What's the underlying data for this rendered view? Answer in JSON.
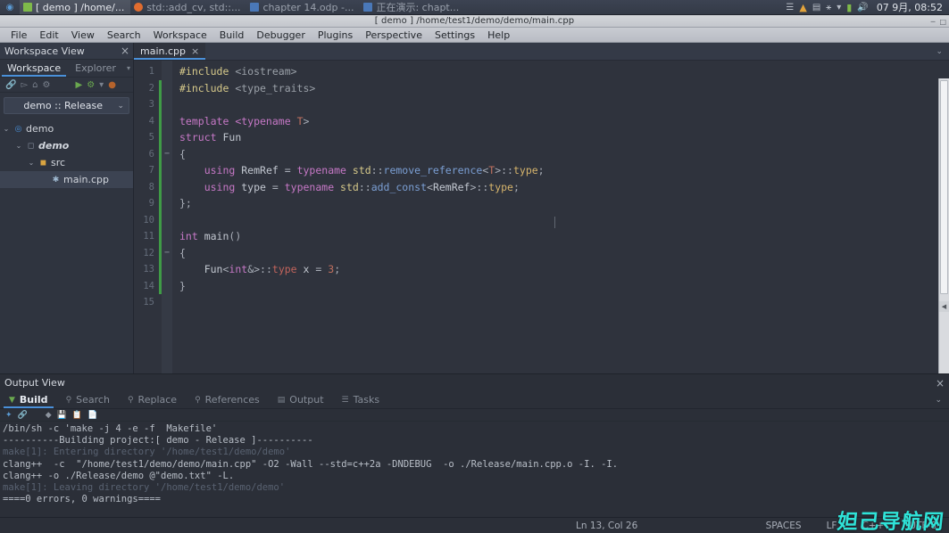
{
  "taskbar": {
    "start_icon": "start-menu-icon",
    "items": [
      {
        "label": "[ demo ] /home/...",
        "icon": "window-icon",
        "active": true
      },
      {
        "label": "std::add_cv, std::...",
        "icon": "browser-icon",
        "active": false
      },
      {
        "label": "chapter 14.odp -...",
        "icon": "presentation-icon",
        "active": false
      },
      {
        "label": "正在演示: chapt...",
        "icon": "presentation-icon",
        "active": false
      }
    ],
    "tray": {
      "network": "network-icon",
      "warning": "warning-icon",
      "keyboard": "keyboard-icon",
      "bluetooth": "bluetooth-icon",
      "wifi": "wifi-icon",
      "battery": "battery-icon",
      "volume": "volume-icon",
      "clock": "07 9月, 08:52"
    }
  },
  "window": {
    "title": "[ demo ] /home/test1/demo/demo/main.cpp",
    "buttons": [
      "minimize",
      "maximize",
      "close"
    ]
  },
  "menubar": {
    "items": [
      "File",
      "Edit",
      "View",
      "Search",
      "Workspace",
      "Build",
      "Debugger",
      "Plugins",
      "Perspective",
      "Settings",
      "Help"
    ]
  },
  "workspace_view": {
    "title": "Workspace View",
    "close": "×",
    "tabs": [
      {
        "label": "Workspace",
        "selected": true
      },
      {
        "label": "Explorer",
        "selected": false
      }
    ],
    "tabs_overflow": "▾",
    "toolbar_icons": [
      "link-icon",
      "send-icon",
      "home-icon",
      "wrench-icon",
      "run-icon",
      "build-icon",
      "dropdown-icon",
      "stop-icon"
    ],
    "config_selector": {
      "value": "demo :: Release",
      "chevron": "⌄"
    },
    "tree": [
      {
        "label": "demo",
        "depth": 0,
        "twisty": "⌄",
        "icon": "project-icon",
        "style": "normal",
        "selected": false
      },
      {
        "label": "demo",
        "depth": 1,
        "twisty": "⌄",
        "icon": "folder-icon",
        "style": "bold-italic",
        "selected": false
      },
      {
        "label": "src",
        "depth": 2,
        "twisty": "⌄",
        "icon": "folder-open-icon",
        "style": "normal",
        "selected": false
      },
      {
        "label": "main.cpp",
        "depth": 3,
        "twisty": "",
        "icon": "cpp-file-icon",
        "style": "normal",
        "selected": true
      }
    ]
  },
  "editor": {
    "tabs": [
      {
        "label": "main.cpp",
        "close": "×",
        "selected": true
      }
    ],
    "overflow_chevron": "⌄",
    "line_count": 15,
    "change_bar": {
      "from_line": 2,
      "to_line": 14,
      "color": "#3f9b46"
    },
    "fold_markers": {
      "6": "−",
      "12": "−"
    },
    "lines": [
      {
        "n": 1,
        "tokens": [
          {
            "t": "#include ",
            "c": "k-pre"
          },
          {
            "t": "<iostream>",
            "c": "k-hdr"
          }
        ]
      },
      {
        "n": 2,
        "tokens": [
          {
            "t": "#include ",
            "c": "k-pre"
          },
          {
            "t": "<type_traits>",
            "c": "k-hdr"
          }
        ]
      },
      {
        "n": 3,
        "tokens": []
      },
      {
        "n": 4,
        "tokens": [
          {
            "t": "template ",
            "c": "k-kw"
          },
          {
            "t": "<typename ",
            "c": "k-kw"
          },
          {
            "t": "T",
            "c": "k-tparam"
          },
          {
            "t": ">",
            "c": "k-punct"
          }
        ]
      },
      {
        "n": 5,
        "tokens": [
          {
            "t": "struct ",
            "c": "k-kw"
          },
          {
            "t": "Fun",
            "c": "k-id"
          }
        ]
      },
      {
        "n": 6,
        "tokens": [
          {
            "t": "{",
            "c": "k-punct"
          }
        ]
      },
      {
        "n": 7,
        "tokens": [
          {
            "t": "    ",
            "c": "k-punct"
          },
          {
            "t": "using ",
            "c": "k-kw"
          },
          {
            "t": "RemRef ",
            "c": "k-id"
          },
          {
            "t": "= ",
            "c": "k-punct"
          },
          {
            "t": "typename ",
            "c": "k-kw"
          },
          {
            "t": "std",
            "c": "k-ns"
          },
          {
            "t": "::",
            "c": "k-punct"
          },
          {
            "t": "remove_reference",
            "c": "k-fn"
          },
          {
            "t": "<",
            "c": "k-punct"
          },
          {
            "t": "T",
            "c": "k-tparam"
          },
          {
            "t": ">::",
            "c": "k-punct"
          },
          {
            "t": "type",
            "c": "k-type"
          },
          {
            "t": ";",
            "c": "k-punct"
          }
        ]
      },
      {
        "n": 8,
        "tokens": [
          {
            "t": "    ",
            "c": "k-punct"
          },
          {
            "t": "using ",
            "c": "k-kw"
          },
          {
            "t": "type ",
            "c": "k-id"
          },
          {
            "t": "= ",
            "c": "k-punct"
          },
          {
            "t": "typename ",
            "c": "k-kw"
          },
          {
            "t": "std",
            "c": "k-ns"
          },
          {
            "t": "::",
            "c": "k-punct"
          },
          {
            "t": "add_const",
            "c": "k-fn"
          },
          {
            "t": "<",
            "c": "k-punct"
          },
          {
            "t": "RemRef",
            "c": "k-id"
          },
          {
            "t": ">::",
            "c": "k-punct"
          },
          {
            "t": "type",
            "c": "k-type"
          },
          {
            "t": ";",
            "c": "k-punct"
          }
        ]
      },
      {
        "n": 9,
        "tokens": [
          {
            "t": "};",
            "c": "k-punct"
          }
        ]
      },
      {
        "n": 10,
        "tokens": []
      },
      {
        "n": 11,
        "tokens": [
          {
            "t": "int ",
            "c": "k-kw"
          },
          {
            "t": "main",
            "c": "k-id"
          },
          {
            "t": "()",
            "c": "k-punct"
          }
        ]
      },
      {
        "n": 12,
        "tokens": [
          {
            "t": "{",
            "c": "k-punct"
          }
        ]
      },
      {
        "n": 13,
        "tokens": [
          {
            "t": "    ",
            "c": "k-punct"
          },
          {
            "t": "Fun",
            "c": "k-id"
          },
          {
            "t": "<",
            "c": "k-punct"
          },
          {
            "t": "int",
            "c": "k-kw"
          },
          {
            "t": "&>::",
            "c": "k-punct"
          },
          {
            "t": "type",
            "c": "k-err"
          },
          {
            "t": " x ",
            "c": "k-id"
          },
          {
            "t": "= ",
            "c": "k-punct"
          },
          {
            "t": "3",
            "c": "k-num"
          },
          {
            "t": ";",
            "c": "k-punct"
          }
        ]
      },
      {
        "n": 14,
        "tokens": [
          {
            "t": "}",
            "c": "k-punct"
          }
        ]
      },
      {
        "n": 15,
        "tokens": []
      }
    ]
  },
  "output_view": {
    "title": "Output View",
    "close": "×",
    "tabs": [
      {
        "label": "Build",
        "icon": "build-icon",
        "selected": true
      },
      {
        "label": "Search",
        "icon": "search-icon",
        "selected": false
      },
      {
        "label": "Replace",
        "icon": "replace-icon",
        "selected": false
      },
      {
        "label": "References",
        "icon": "references-icon",
        "selected": false
      },
      {
        "label": "Output",
        "icon": "output-icon",
        "selected": false
      },
      {
        "label": "Tasks",
        "icon": "tasks-icon",
        "selected": false
      }
    ],
    "overflow_chevron": "⌄",
    "toolbar_icons": [
      "pin-icon",
      "link-icon",
      "clear-icon",
      "save-icon",
      "copy-icon",
      "paste-icon"
    ],
    "log": [
      {
        "text": "/bin/sh -c 'make -j 4 -e -f  Makefile'",
        "style": "lg-norm"
      },
      {
        "text": "----------Building project:[ demo - Release ]----------",
        "style": "lg-norm"
      },
      {
        "text": "make[1]: Entering directory '/home/test1/demo/demo'",
        "style": "lg-dim"
      },
      {
        "text": "clang++  -c  \"/home/test1/demo/demo/main.cpp\" -O2 -Wall --std=c++2a -DNDEBUG  -o ./Release/main.cpp.o -I. -I.",
        "style": "lg-norm"
      },
      {
        "text": "clang++ -o ./Release/demo @\"demo.txt\" -L.",
        "style": "lg-norm"
      },
      {
        "text": "make[1]: Leaving directory '/home/test1/demo/demo'",
        "style": "lg-dim"
      },
      {
        "text": "====0 errors, 0 warnings====",
        "style": "lg-norm"
      }
    ]
  },
  "statusbar": {
    "position": "Ln 13, Col 26",
    "indent": "SPACES",
    "eol": "LF",
    "language": "C++",
    "encoding": "UTF-8"
  },
  "watermark": {
    "text": "妲己导航网",
    "color": "#2fe3d8"
  }
}
